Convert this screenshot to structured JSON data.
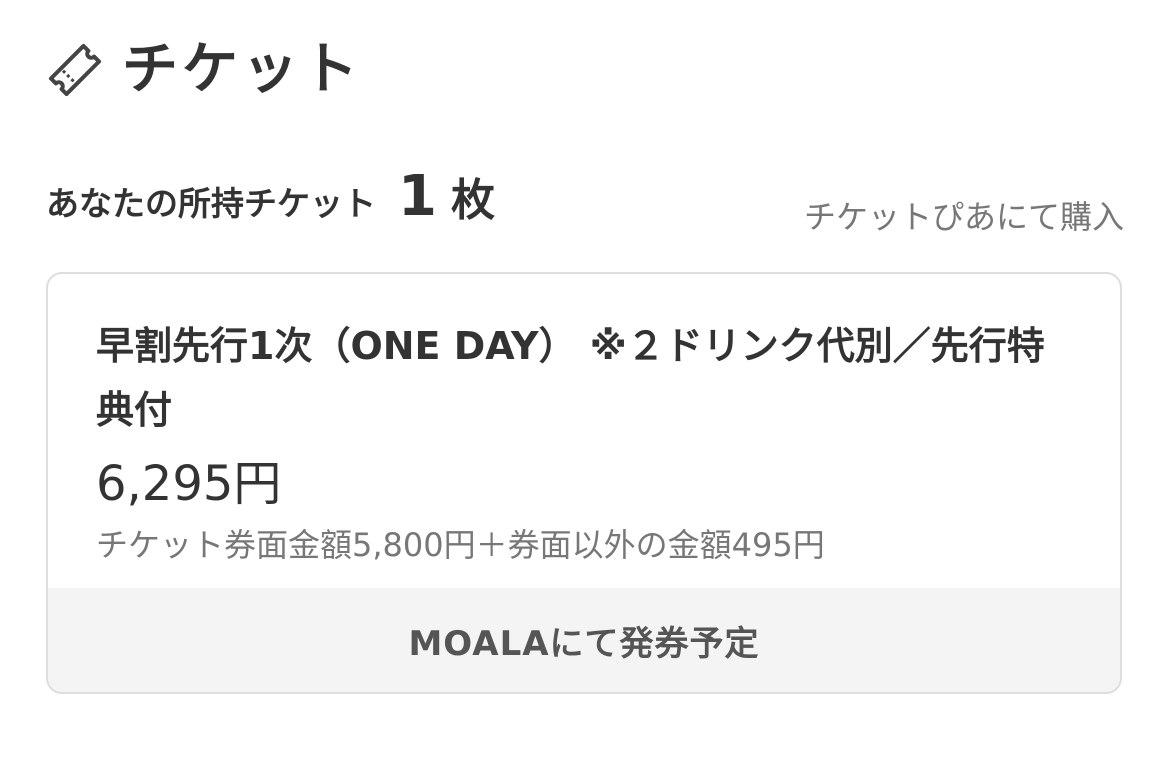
{
  "header": {
    "icon": "ticket-icon",
    "title": "チケット"
  },
  "owned": {
    "label": "あなたの所持チケット",
    "count": "1",
    "unit": "枚"
  },
  "buy_link": "チケットぴあにて購入",
  "ticket": {
    "name": "早割先行1次（ONE DAY） ※２ドリンク代別／先行特典付",
    "price": "6,295円",
    "price_detail": "チケット券面金額5,800円＋券面以外の金額495円",
    "issue_info": "MOALAにて発券予定"
  },
  "colors": {
    "text": "#333333",
    "muted": "#777777",
    "card_border": "#dedede",
    "footer_bg": "#f4f4f4"
  }
}
